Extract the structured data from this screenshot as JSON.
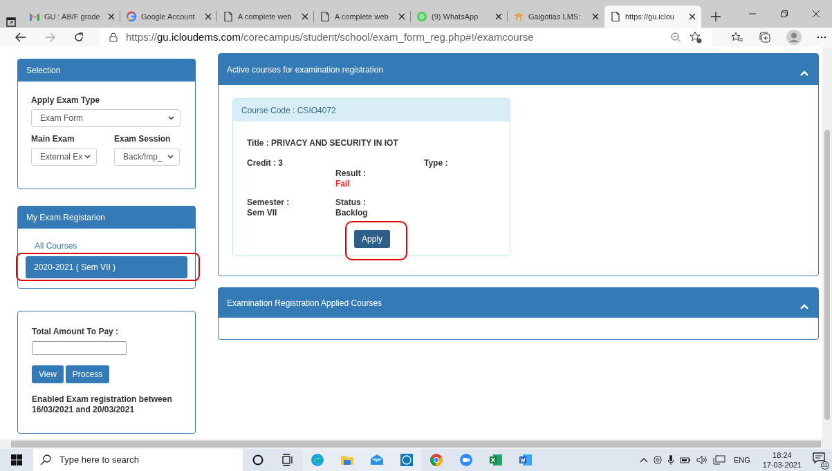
{
  "browser": {
    "tabs": [
      {
        "title": "GU : AB/F grade",
        "kind": "gmail",
        "selected": false
      },
      {
        "title": "Google Account",
        "kind": "google",
        "selected": false
      },
      {
        "title": "A complete web",
        "kind": "page",
        "selected": false
      },
      {
        "title": "A complete web",
        "kind": "page",
        "selected": false
      },
      {
        "title": "(9) WhatsApp",
        "kind": "whatsapp",
        "selected": false
      },
      {
        "title": "Galgotias LMS:",
        "kind": "lms",
        "selected": false
      },
      {
        "title": "https://gu.iclou",
        "kind": "page",
        "selected": true
      }
    ],
    "address": {
      "scheme": "https://",
      "host": "gu.icloudems.com",
      "path": "/corecampus/student/school/exam_form_reg.php#!/examcourse"
    }
  },
  "sidebar": {
    "selection": {
      "title": "Selection",
      "fields": [
        {
          "label": "Apply Exam Type",
          "value": "Exam Form"
        },
        {
          "label": "Main Exam",
          "value": "External Ex"
        },
        {
          "label": "Exam Session",
          "value": "Back/Imp_"
        }
      ]
    },
    "registration": {
      "title": "My Exam Registarion",
      "items": [
        {
          "label": "All Courses",
          "selected": false,
          "highlighted": false
        },
        {
          "label": "2020-2021 ( Sem VII )",
          "selected": true,
          "highlighted": true
        }
      ]
    },
    "payment": {
      "label": "Total Amount To Pay :",
      "buttons": [
        "View",
        "Process"
      ],
      "note": "Enabled Exam registration between 16/03/2021 and 20/03/2021"
    }
  },
  "main": {
    "active": {
      "title": "Active courses for examination registration",
      "expanded": true,
      "courses": [
        {
          "code": "Course Code : CSIO4072",
          "title": "Title : PRIVACY AND SECURITY IN IOT",
          "credit": "Credit : 3",
          "type": "Type :",
          "result_label": "Result :",
          "result": "Fail",
          "semester_label": "Semester :",
          "semester": "Sem VII",
          "status_label": "Status :",
          "status": "Backlog",
          "button": "Apply",
          "button_highlighted": true
        }
      ]
    },
    "applied": {
      "title": "Examination Registration Applied Courses",
      "expanded": true
    }
  },
  "taskbar": {
    "search_placeholder": "Type here to search",
    "language": "ENG",
    "time": "18:24",
    "date": "17-03-2021",
    "notifications": "11"
  }
}
